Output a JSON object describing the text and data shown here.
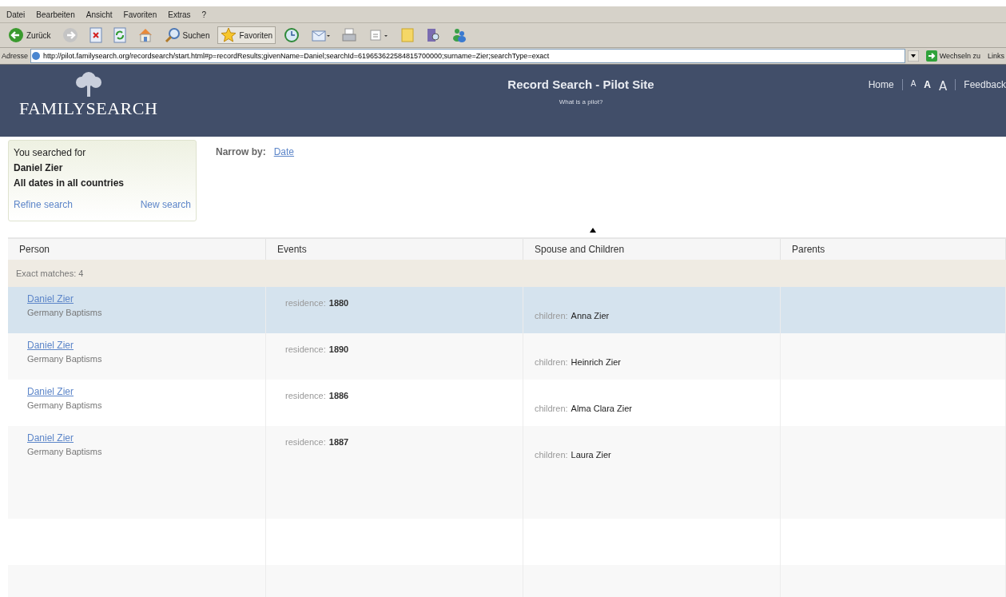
{
  "menu_bar": [
    "Datei",
    "Bearbeiten",
    "Ansicht",
    "Favoriten",
    "Extras",
    "?"
  ],
  "toolbar": [
    {
      "kind": "back",
      "label": "Zurück"
    },
    {
      "kind": "forward"
    },
    {
      "kind": "stop"
    },
    {
      "kind": "refresh"
    },
    {
      "kind": "home"
    },
    {
      "kind": "search",
      "label": "Suchen"
    },
    {
      "kind": "favorites",
      "label": "Favoriten",
      "selected": true
    },
    {
      "kind": "history"
    },
    {
      "kind": "mail"
    },
    {
      "kind": "print"
    },
    {
      "kind": "edit"
    },
    {
      "kind": "folder"
    },
    {
      "kind": "research"
    },
    {
      "kind": "messenger"
    }
  ],
  "address_bar": {
    "label": "Adresse",
    "value": "http://pilot.familysearch.org/recordsearch/start.html#p=recordResults;givenName=Daniel;searchId=619653622584815700000;surname=Zier;searchType=exact",
    "go_label": "Wechseln zu",
    "links_label": "Links"
  },
  "banner": {
    "logo": "FAMILYSEARCH",
    "title": "Record Search - Pilot Site",
    "subtitle": "What is a pilot?",
    "nav": [
      {
        "label": "Home",
        "kind": "link"
      },
      {
        "label": "A",
        "kind": "size-small"
      },
      {
        "label": "A",
        "kind": "size-bold"
      },
      {
        "label": "A",
        "kind": "size-large"
      },
      {
        "label": "Feedback",
        "kind": "link"
      }
    ]
  },
  "search_summary": {
    "heading": "You searched for",
    "name": "Daniel Zier",
    "scope": "All dates in all countries",
    "links": [
      "Refine search",
      "New search"
    ]
  },
  "narrow_by": {
    "label": "Narrow by:",
    "options": [
      "Date"
    ]
  },
  "table": {
    "columns": [
      "Person",
      "Events",
      "Spouse and Children",
      "Parents"
    ],
    "group_label": "Exact matches: 4",
    "rows": [
      {
        "name": "Daniel Zier",
        "collection": "Germany Baptisms",
        "event_label": "residence:",
        "event_value": "1880",
        "family_label": "children:",
        "family_value": "Anna Zier",
        "selected": true
      },
      {
        "name": "Daniel Zier",
        "collection": "Germany Baptisms",
        "event_label": "residence:",
        "event_value": "1890",
        "family_label": "children:",
        "family_value": "Heinrich Zier",
        "selected": false
      },
      {
        "name": "Daniel Zier",
        "collection": "Germany Baptisms",
        "event_label": "residence:",
        "event_value": "1886",
        "family_label": "children:",
        "family_value": "Alma Clara Zier",
        "selected": false
      },
      {
        "name": "Daniel Zier",
        "collection": "Germany Baptisms",
        "event_label": "residence:",
        "event_value": "1887",
        "family_label": "children:",
        "family_value": "Laura Zier",
        "selected": false
      }
    ]
  }
}
